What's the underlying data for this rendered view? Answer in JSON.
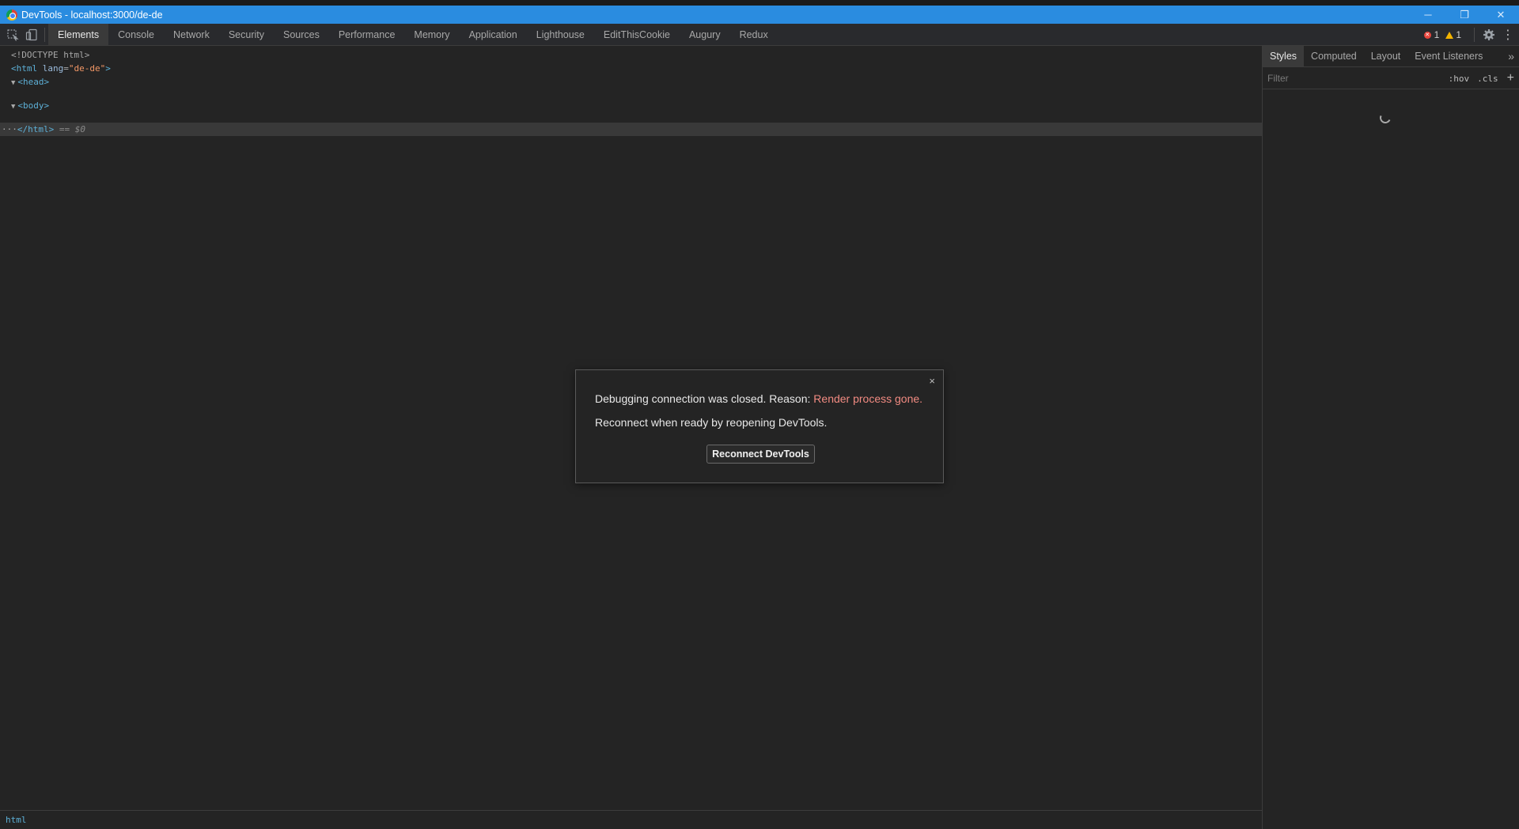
{
  "window": {
    "title": "DevTools - localhost:3000/de-de",
    "minimize": "─",
    "restore": "❐",
    "close": "✕"
  },
  "toolbar": {
    "tabs": [
      {
        "label": "Elements",
        "active": true
      },
      {
        "label": "Console"
      },
      {
        "label": "Network"
      },
      {
        "label": "Security"
      },
      {
        "label": "Sources"
      },
      {
        "label": "Performance"
      },
      {
        "label": "Memory"
      },
      {
        "label": "Application"
      },
      {
        "label": "Lighthouse"
      },
      {
        "label": "EditThisCookie"
      },
      {
        "label": "Augury"
      },
      {
        "label": "Redux"
      }
    ],
    "errors": "1",
    "warnings": "1",
    "error_symbol": "✕",
    "more": "⋮"
  },
  "elements": {
    "doctype": "<!DOCTYPE html>",
    "html_open_tag": "<html",
    "html_attr": "lang",
    "html_attr_value": "\"de-de\"",
    "html_close_bracket": ">",
    "html_equals": "=",
    "head": "<head>",
    "body": "<body>",
    "triangle": "▼",
    "selected_prefix": "···",
    "selected_tag": "</html>",
    "selected_suffix": "== $0"
  },
  "sidebar": {
    "tabs": [
      {
        "label": "Styles",
        "active": true
      },
      {
        "label": "Computed"
      },
      {
        "label": "Layout"
      },
      {
        "label": "Event Listeners"
      }
    ],
    "more": "»",
    "filter_placeholder": "Filter",
    "hov": ":hov",
    "cls": ".cls",
    "plus": "+"
  },
  "statusbar": {
    "crumb": "html"
  },
  "dialog": {
    "close": "×",
    "message": "Debugging connection was closed. Reason: ",
    "reason": "Render process gone.",
    "hint": "Reconnect when ready by reopening DevTools.",
    "button": "Reconnect DevTools"
  }
}
